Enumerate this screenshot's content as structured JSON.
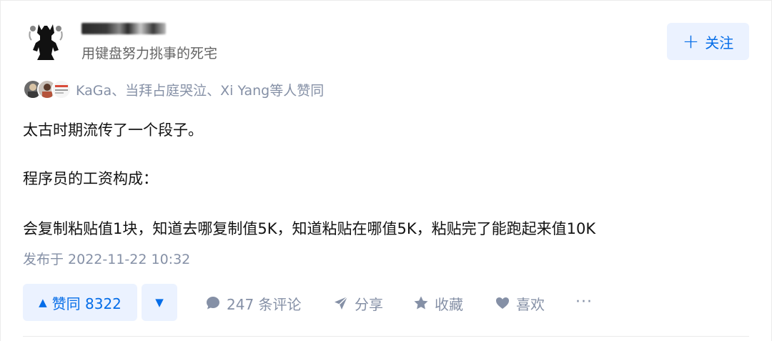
{
  "author": {
    "name": "████...",
    "bio": "用键盘努力挑事的死宅"
  },
  "follow": {
    "icon": "plus-icon",
    "label": "关注"
  },
  "voters": {
    "text": "KaGa、当拜占庭哭泣、Xi Yang等人赞同",
    "avatar_count": 3
  },
  "content": {
    "paragraphs": [
      "太古时期流传了一个段子。",
      "程序员的工资构成：",
      "会复制粘贴值1块，知道去哪复制值5K，知道粘贴在哪值5K，粘贴完了能跑起来值10K"
    ]
  },
  "publish_time": "发布于 2022-11-22 10:32",
  "actions": {
    "upvote_label": "赞同 8322",
    "downvote_icon": "triangle-down-icon",
    "comments_label": "247 条评论",
    "share_label": "分享",
    "favorite_label": "收藏",
    "like_label": "喜欢",
    "more_label": "···"
  },
  "colors": {
    "accent": "#056de8",
    "accent_bg": "#ebf2ff",
    "muted": "#8590a6"
  }
}
